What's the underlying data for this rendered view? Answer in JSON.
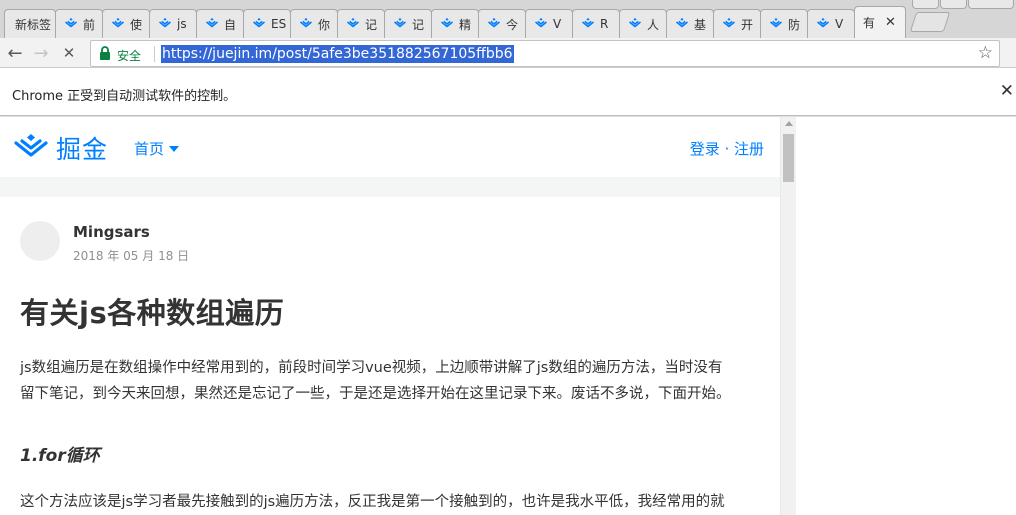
{
  "browser": {
    "tabs": [
      {
        "title": "新标签",
        "favicon": "none"
      },
      {
        "title": "前",
        "favicon": "juejin-icon"
      },
      {
        "title": "使",
        "favicon": "juejin-icon"
      },
      {
        "title": "js",
        "favicon": "juejin-icon"
      },
      {
        "title": "自",
        "favicon": "juejin-icon"
      },
      {
        "title": "ES",
        "favicon": "juejin-icon"
      },
      {
        "title": "你",
        "favicon": "juejin-icon"
      },
      {
        "title": "记",
        "favicon": "juejin-icon"
      },
      {
        "title": "记",
        "favicon": "juejin-icon"
      },
      {
        "title": "精",
        "favicon": "juejin-icon"
      },
      {
        "title": "今",
        "favicon": "juejin-icon"
      },
      {
        "title": "V",
        "favicon": "juejin-icon"
      },
      {
        "title": "R",
        "favicon": "juejin-icon"
      },
      {
        "title": "人",
        "favicon": "juejin-icon"
      },
      {
        "title": "基",
        "favicon": "juejin-icon"
      },
      {
        "title": "开",
        "favicon": "juejin-icon"
      },
      {
        "title": "防",
        "favicon": "juejin-icon"
      },
      {
        "title": "V",
        "favicon": "juejin-icon"
      }
    ],
    "active_tab": {
      "title": "有",
      "close": "✕"
    },
    "nav": {
      "back": "←",
      "forward": "→",
      "reload": "✕"
    },
    "omnibox": {
      "secure_label": "安全",
      "url": "https://juejin.im/post/5afe3be351882567105ffbb6",
      "bookmark": "☆"
    },
    "infobar": {
      "message": "Chrome 正受到自动测试软件的控制。",
      "close": "✕"
    },
    "accent_color": "#3367d6"
  },
  "site": {
    "logo_text": "掘金",
    "nav_home": "首页",
    "auth": "登录 · 注册",
    "brand_color": "#007fff"
  },
  "article": {
    "author": "Mingsars",
    "date": "2018 年 05 月 18 日",
    "title": "有关js各种数组遍历",
    "para1_line1": "js数组遍历是在数组操作中经常用到的，前段时间学习vue视频，上边顺带讲解了js数组的遍历方法，当时没有",
    "para1_line2": "留下笔记，到今天来回想，果然还是忘记了一些，于是还是选择开始在这里记录下来。废话不多说，下面开始。",
    "heading": "1.for循环",
    "para2": "这个方法应该是js学习者最先接触到的js遍历方法，反正我是第一个接触到的，也许是我水平低，我经常用的就"
  }
}
